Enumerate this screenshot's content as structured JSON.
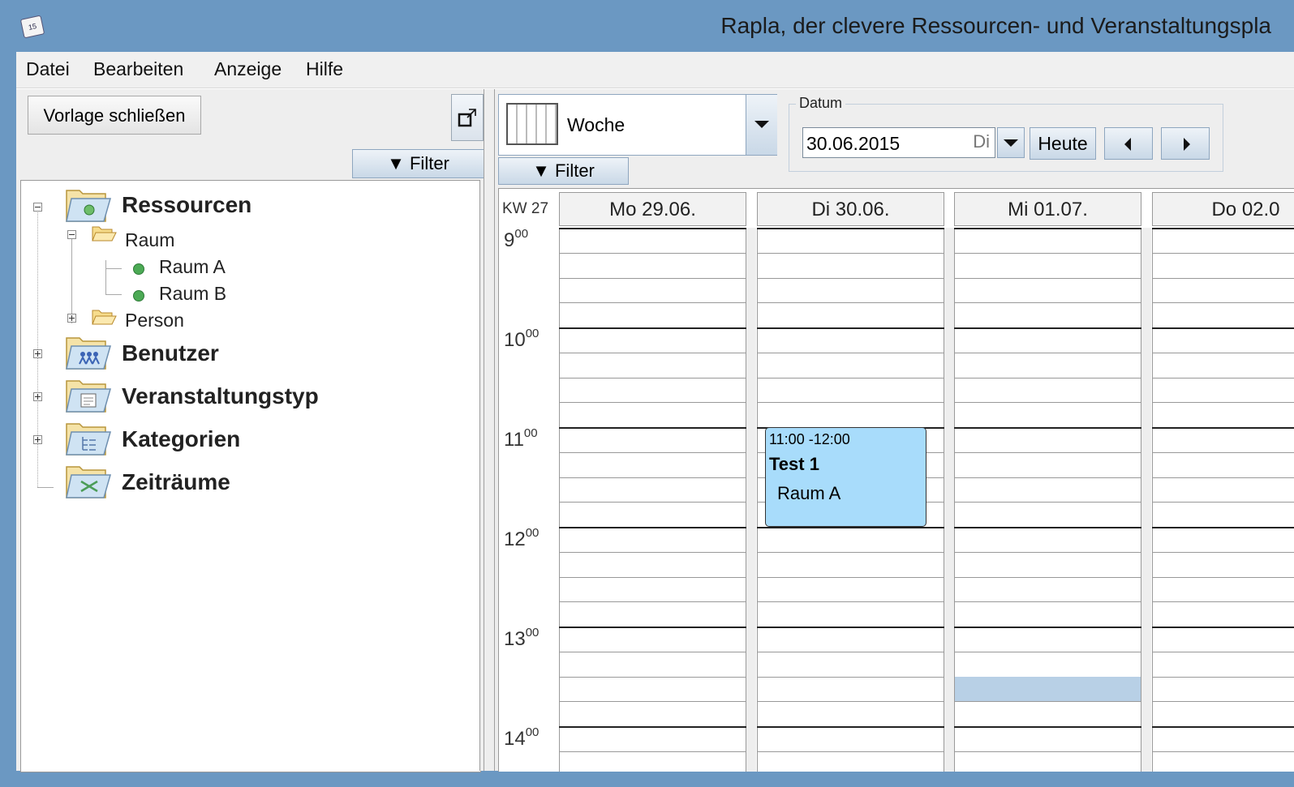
{
  "window": {
    "title": "Rapla, der clevere Ressourcen- und Veranstaltungspla",
    "icon_text": "15"
  },
  "menu": {
    "items": [
      "Datei",
      "Bearbeiten",
      "Anzeige",
      "Hilfe"
    ]
  },
  "left_panel": {
    "close_template_label": "Vorlage schließen",
    "filter_label": "▼ Filter",
    "tree": {
      "ressourcen": {
        "label": "Ressourcen",
        "expanded": true
      },
      "raum": {
        "label": "Raum",
        "expanded": true
      },
      "raum_a": {
        "label": "Raum A"
      },
      "raum_b": {
        "label": "Raum B"
      },
      "person": {
        "label": "Person",
        "expanded": false
      },
      "benutzer": {
        "label": "Benutzer",
        "expanded": false
      },
      "veranstaltungstyp": {
        "label": "Veranstaltungstyp",
        "expanded": false
      },
      "kategorien": {
        "label": "Kategorien",
        "expanded": false
      },
      "zeitraeume": {
        "label": "Zeiträume"
      }
    }
  },
  "toolbar": {
    "view_label": "Woche",
    "filter_label": "▼ Filter",
    "date_group_label": "Datum",
    "date_value": "30.06.2015",
    "date_weekday": "Di",
    "today_label": "Heute"
  },
  "calendar": {
    "week_label": "KW 27",
    "days": [
      "Mo 29.06.",
      "Di 30.06.",
      "Mi 01.07.",
      "Do 02.0"
    ],
    "hours": [
      {
        "h": "9",
        "m": "00"
      },
      {
        "h": "10",
        "m": "00"
      },
      {
        "h": "11",
        "m": "00"
      },
      {
        "h": "12",
        "m": "00"
      },
      {
        "h": "13",
        "m": "00"
      },
      {
        "h": "14",
        "m": "00"
      }
    ],
    "event": {
      "time": "11:00 -12:00",
      "title": "Test 1",
      "resource": "Raum A",
      "color": "#a8dcfb"
    },
    "selection_color": "#b8d0e6"
  },
  "colors": {
    "titlebar": "#6b98c2",
    "panel": "#eeeeee"
  }
}
